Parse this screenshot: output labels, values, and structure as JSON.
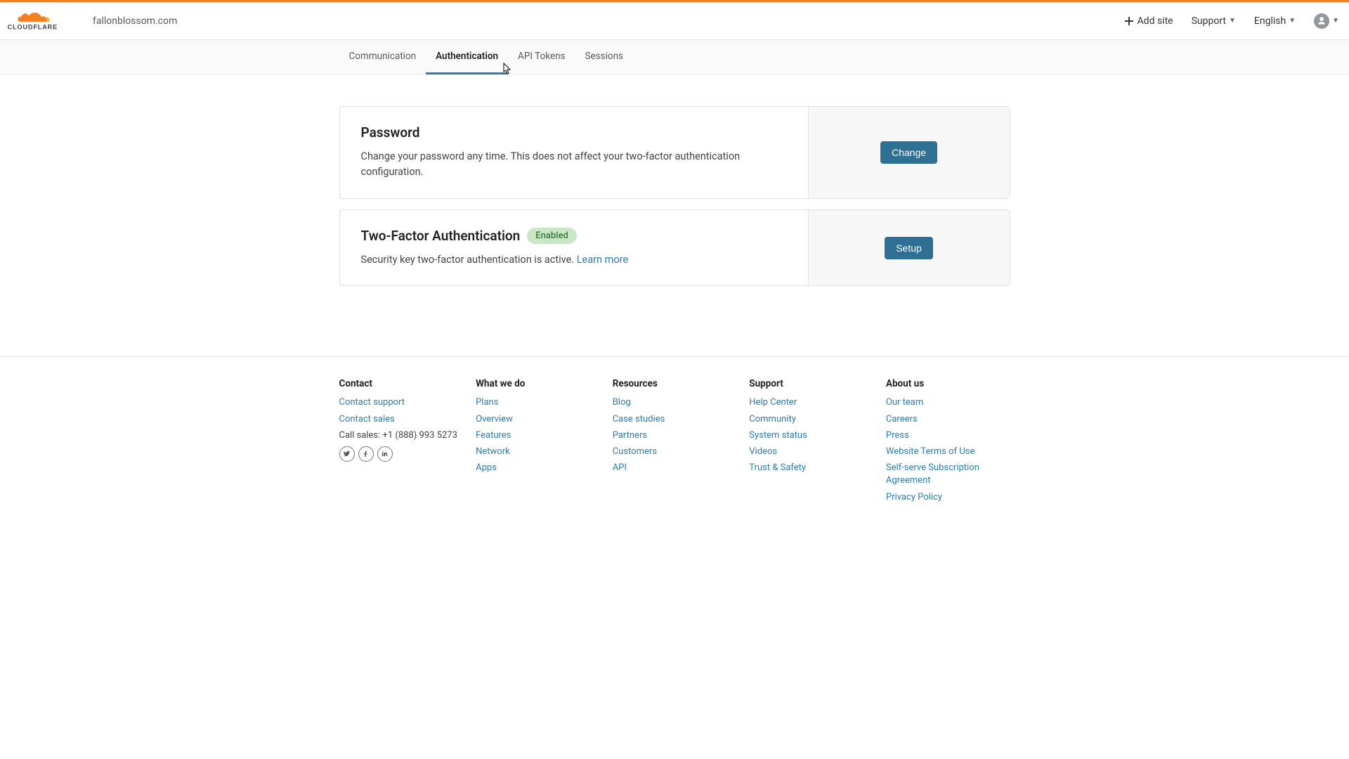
{
  "header": {
    "domain": "fallonblossom.com",
    "add_site": "Add site",
    "support": "Support",
    "language": "English"
  },
  "tabs": {
    "communication": "Communication",
    "authentication": "Authentication",
    "api_tokens": "API Tokens",
    "sessions": "Sessions"
  },
  "cards": {
    "password": {
      "title": "Password",
      "desc": "Change your password any time. This does not affect your two-factor authentication configuration.",
      "button": "Change"
    },
    "tfa": {
      "title": "Two-Factor Authentication",
      "badge": "Enabled",
      "desc_prefix": "Security key two-factor authentication is active. ",
      "learn_more": "Learn more",
      "button": "Setup"
    }
  },
  "footer": {
    "contact": {
      "title": "Contact",
      "support": "Contact support",
      "sales": "Contact sales",
      "call": "Call sales: +1 (888) 993 5273"
    },
    "whatwedo": {
      "title": "What we do",
      "items": [
        "Plans",
        "Overview",
        "Features",
        "Network",
        "Apps"
      ]
    },
    "resources": {
      "title": "Resources",
      "items": [
        "Blog",
        "Case studies",
        "Partners",
        "Customers",
        "API"
      ]
    },
    "support": {
      "title": "Support",
      "items": [
        "Help Center",
        "Community",
        "System status",
        "Videos",
        "Trust & Safety"
      ]
    },
    "about": {
      "title": "About us",
      "items": [
        "Our team",
        "Careers",
        "Press",
        "Website Terms of Use",
        "Self-serve Subscription Agreement",
        "Privacy Policy"
      ]
    }
  }
}
